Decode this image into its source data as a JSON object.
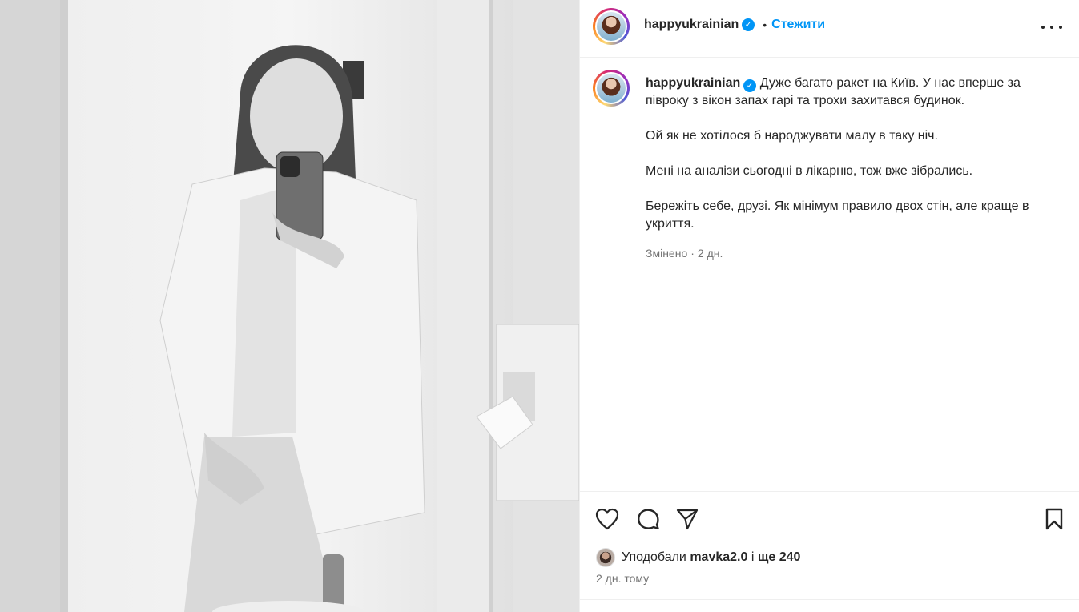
{
  "post": {
    "photo_alt": "Black and white mirror selfie",
    "author": {
      "username": "happyukrainian",
      "verified_icon": "verified-badge-icon",
      "follow_label": "Стежити",
      "separator": "•"
    },
    "caption": {
      "username": "happyukrainian",
      "paragraphs": [
        "Дуже багато ракет на Київ. У нас вперше за півроку з вікон запах гарі та трохи захитався будинок.",
        "Ой як не хотілося б народжувати малу в таку ніч.",
        "Мені на аналізи сьогодні в лікарню, тож вже зібрались.",
        "Бережіть себе, друзі. Як мінімум правило двох стін, але краще в укриття."
      ],
      "edited_label": "Змінено",
      "edited_sep": "·",
      "edited_time": "2 дн."
    },
    "actions": {
      "like_icon": "heart-icon",
      "comment_icon": "comment-icon",
      "share_icon": "send-icon",
      "save_icon": "bookmark-icon"
    },
    "likes": {
      "prefix": "Уподобали",
      "user": "mavka2.0",
      "middle": "і",
      "rest": "ще 240"
    },
    "time_ago": "2 дн. тому"
  },
  "colors": {
    "accent": "#0095f6",
    "text": "#262626",
    "secondary": "#737373",
    "border": "#efefef"
  }
}
